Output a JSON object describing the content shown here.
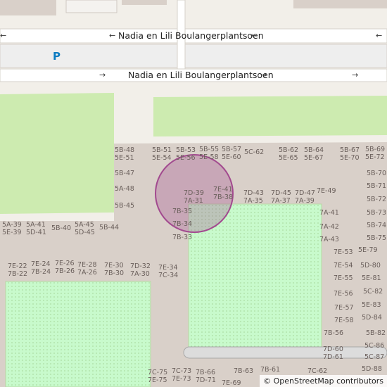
{
  "map": {
    "streets": [
      {
        "name": "Nadia en Lili Boulangerplantsoen",
        "id": "street-top"
      },
      {
        "name": "Nadia en Lili Boulangerplantsoen",
        "id": "street-bottom"
      }
    ],
    "parking_label": "P",
    "attribution": "© OpenStreetMap contributors",
    "colors": {
      "background": "#f2efe9",
      "road": "#ffffff",
      "grass": "#cdebb0",
      "park": "#c8facc",
      "building_area": "#d9d0c9",
      "marker": "#a24a8f"
    },
    "house_numbers": [
      [
        "5B-48",
        "5E-51"
      ],
      [
        "5B-51",
        "5E-54"
      ],
      [
        "5B-53",
        "5E-56"
      ],
      [
        "5B-55",
        "5E-58"
      ],
      [
        "5B-57",
        "5E-60"
      ],
      [
        "5C-62"
      ],
      [
        "5B-62",
        "5E-65"
      ],
      [
        "5B-64",
        "5E-67"
      ],
      [
        "5B-67",
        "5E-70"
      ],
      [
        "5B-69",
        "5E-72"
      ],
      [
        "5B-47"
      ],
      [
        "5B-70"
      ],
      [
        "5A-48"
      ],
      [
        "5B-71"
      ],
      [
        "5B-45"
      ],
      [
        "5B-72"
      ],
      [
        "5B-73"
      ],
      [
        "5B-74"
      ],
      [
        "5B-75"
      ],
      [
        "7D-39",
        "7A-31"
      ],
      [
        "7E-41",
        "7B-38"
      ],
      [
        "7B-35"
      ],
      [
        "7B-34"
      ],
      [
        "7B-33"
      ],
      [
        "7D-43",
        "7A-35"
      ],
      [
        "7D-45",
        "7A-37"
      ],
      [
        "7D-47",
        "7A-39"
      ],
      [
        "7E-49"
      ],
      [
        "7A-41"
      ],
      [
        "7A-42"
      ],
      [
        "7A-43"
      ],
      [
        "5A-39",
        "5E-39"
      ],
      [
        "5A-41",
        "5D-41"
      ],
      [
        "5B-40"
      ],
      [
        "5A-45",
        "5D-45"
      ],
      [
        "5B-44"
      ],
      [
        "7E-22",
        "7B-22"
      ],
      [
        "7E-24",
        "7B-24"
      ],
      [
        "7E-26",
        "7B-26"
      ],
      [
        "7E-28",
        "7A-26"
      ],
      [
        "7E-30",
        "7B-30"
      ],
      [
        "7D-32",
        "7A-30"
      ],
      [
        "7E-34",
        "7C-34"
      ],
      [
        "7E-53"
      ],
      [
        "5E-79"
      ],
      [
        "7E-54"
      ],
      [
        "5D-80"
      ],
      [
        "7E-55"
      ],
      [
        "5E-81"
      ],
      [
        "7E-56"
      ],
      [
        "5C-82"
      ],
      [
        "7E-57"
      ],
      [
        "5E-83"
      ],
      [
        "7E-58"
      ],
      [
        "5D-84"
      ],
      [
        "7B-56"
      ],
      [
        "5B-82"
      ],
      [
        "7D-60",
        "7D-61"
      ],
      [
        "5C-86"
      ],
      [
        "5C-87"
      ],
      [
        "5D-88"
      ],
      [
        "7C-75",
        "7E-75"
      ],
      [
        "7C-73",
        "7E-73"
      ],
      [
        "7B-66",
        "7D-71"
      ],
      [
        "7E-69"
      ],
      [
        "7B-63"
      ],
      [
        "7B-61"
      ],
      [
        "7C-62"
      ]
    ]
  }
}
